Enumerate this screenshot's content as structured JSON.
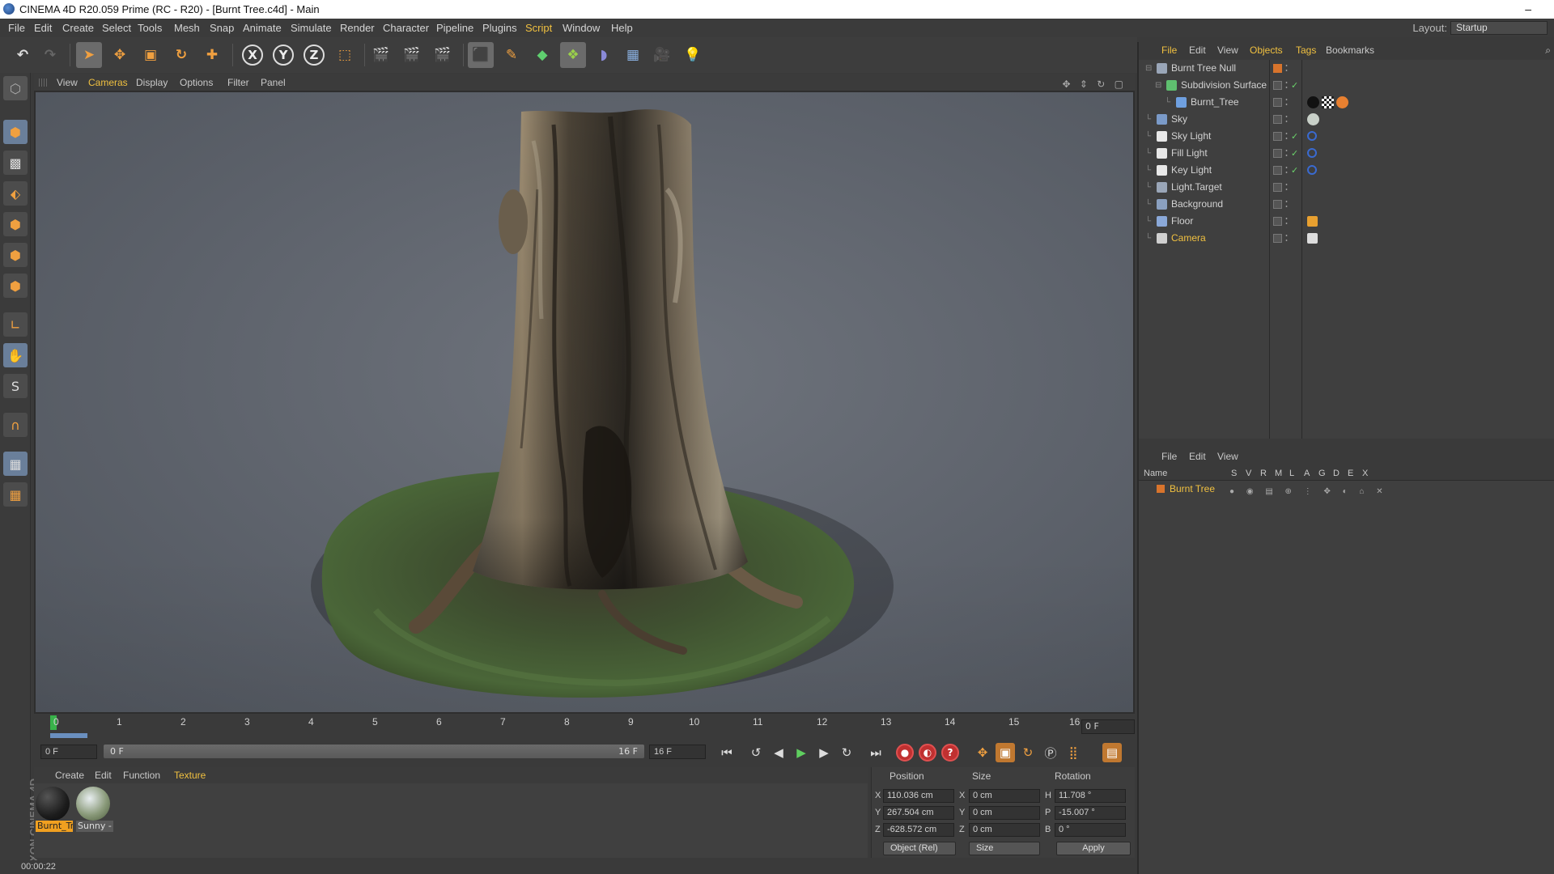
{
  "window": {
    "title": "CINEMA 4D R20.059 Prime (RC - R20) - [Burnt Tree.c4d] - Main",
    "minimize": "–"
  },
  "menu": {
    "items": [
      "File",
      "Edit",
      "Create",
      "Select",
      "Tools",
      "Mesh",
      "Snap",
      "Animate",
      "Simulate",
      "Render",
      "Character",
      "Pipeline",
      "Plugins",
      "Script",
      "Window",
      "Help"
    ],
    "highlighted": [
      "Script"
    ],
    "layout_label": "Layout:",
    "layout_value": "Startup"
  },
  "viewport": {
    "menu": [
      "View",
      "Cameras",
      "Display",
      "Options",
      "Filter",
      "Panel"
    ],
    "highlighted": [
      "Cameras"
    ],
    "nav_icons": "✥ ⇕ ↻ ▢"
  },
  "timeline": {
    "frames": [
      "0",
      "1",
      "2",
      "3",
      "4",
      "5",
      "6",
      "7",
      "8",
      "9",
      "10",
      "11",
      "12",
      "13",
      "14",
      "15",
      "16"
    ],
    "current_frame_field": "0 F",
    "start_field": "0 F",
    "range_start": "0 F",
    "range_end": "16 F",
    "end_field": "16 F"
  },
  "material_manager": {
    "menu": [
      "Create",
      "Edit",
      "Function",
      "Texture"
    ],
    "highlighted": [
      "Texture"
    ],
    "materials": [
      {
        "label": "Burnt_Tr",
        "selected": true,
        "color": "#1c1c1c"
      },
      {
        "label": "Sunny -",
        "selected": false,
        "color": "#8a9a7a"
      }
    ]
  },
  "coordinates": {
    "headers": [
      "Position",
      "Size",
      "Rotation"
    ],
    "rows": [
      {
        "axis": "X",
        "pos": "110.036 cm",
        "size_axis": "X",
        "size": "0 cm",
        "rot_axis": "H",
        "rot": "11.708 °"
      },
      {
        "axis": "Y",
        "pos": "267.504 cm",
        "size_axis": "Y",
        "size": "0 cm",
        "rot_axis": "P",
        "rot": "-15.007 °"
      },
      {
        "axis": "Z",
        "pos": "-628.572 cm",
        "size_axis": "Z",
        "size": "0 cm",
        "rot_axis": "B",
        "rot": "0 °"
      }
    ],
    "mode": "Object (Rel)",
    "size_mode": "Size",
    "apply": "Apply"
  },
  "status": {
    "time": "00:00:22"
  },
  "object_manager": {
    "menu": [
      "File",
      "Edit",
      "View",
      "Objects",
      "Tags",
      "Bookmarks"
    ],
    "highlighted": [
      "File",
      "Objects",
      "Tags"
    ],
    "objects": [
      {
        "name": "Burnt Tree Null",
        "indent": 0,
        "icon_color": "#9aa6b8",
        "highlighted": false
      },
      {
        "name": "Subdivision Surface",
        "indent": 1,
        "icon_color": "#5fbf6f",
        "highlighted": false
      },
      {
        "name": "Burnt_Tree",
        "indent": 2,
        "icon_color": "#6fa0e0",
        "highlighted": false
      },
      {
        "name": "Sky",
        "indent": 0,
        "icon_color": "#7a9ac8",
        "highlighted": false
      },
      {
        "name": "Sky Light",
        "indent": 0,
        "icon_color": "#e8e8e8",
        "highlighted": false
      },
      {
        "name": "Fill Light",
        "indent": 0,
        "icon_color": "#e8e8e8",
        "highlighted": false
      },
      {
        "name": "Key Light",
        "indent": 0,
        "icon_color": "#e8e8e8",
        "highlighted": false
      },
      {
        "name": "Light.Target",
        "indent": 0,
        "icon_color": "#9aa6b8",
        "highlighted": false
      },
      {
        "name": "Background",
        "indent": 0,
        "icon_color": "#8aa0c0",
        "highlighted": false
      },
      {
        "name": "Floor",
        "indent": 0,
        "icon_color": "#8aa8d8",
        "highlighted": false
      },
      {
        "name": "Camera",
        "indent": 0,
        "icon_color": "#cfcfcf",
        "highlighted": true
      }
    ]
  },
  "layer_manager": {
    "menu": [
      "File",
      "Edit",
      "View"
    ],
    "columns": [
      "Name",
      "S",
      "V",
      "R",
      "M",
      "L",
      "A",
      "G",
      "D",
      "E",
      "X"
    ],
    "layer_name": "Burnt Tree"
  },
  "colors": {
    "accent": "#f0c040",
    "bg": "#3a3a3a",
    "selection": "#6a7f9a"
  }
}
